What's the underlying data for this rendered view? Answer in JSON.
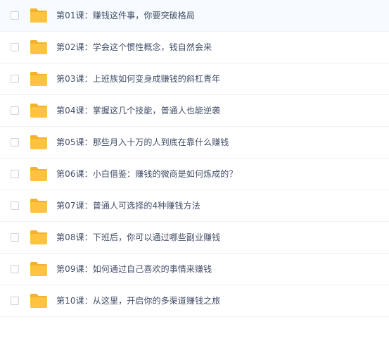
{
  "colors": {
    "folder_body": "#ffc340",
    "folder_tab": "#f5b12e",
    "text": "#424e67",
    "divider": "#eef0f4",
    "checkbox_border": "#cbd3dc"
  },
  "files": [
    {
      "name": "第01课：赚钱这件事，你要突破格局",
      "icon": "folder-icon",
      "checked": false
    },
    {
      "name": "第02课：学会这个惯性概念，钱自然会来",
      "icon": "folder-icon",
      "checked": false
    },
    {
      "name": "第03课：上班族如何变身成赚钱的斜杠青年",
      "icon": "folder-icon",
      "checked": false
    },
    {
      "name": "第04课：掌握这几个技能，普通人也能逆袭",
      "icon": "folder-icon",
      "checked": false
    },
    {
      "name": "第05课：那些月入十万的人到底在靠什么赚钱",
      "icon": "folder-icon",
      "checked": false
    },
    {
      "name": "第06课：小白借鉴：赚钱的微商是如何炼成的？",
      "icon": "folder-icon",
      "checked": false
    },
    {
      "name": "第07课：普通人可选择的4种赚钱方法",
      "icon": "folder-icon",
      "checked": false
    },
    {
      "name": "第08课：下班后，你可以通过哪些副业赚钱",
      "icon": "folder-icon",
      "checked": false
    },
    {
      "name": "第09课：如何通过自己喜欢的事情来赚钱",
      "icon": "folder-icon",
      "checked": false
    },
    {
      "name": "第10课：从这里，开启你的多渠道赚钱之旅",
      "icon": "folder-icon",
      "checked": false
    }
  ]
}
